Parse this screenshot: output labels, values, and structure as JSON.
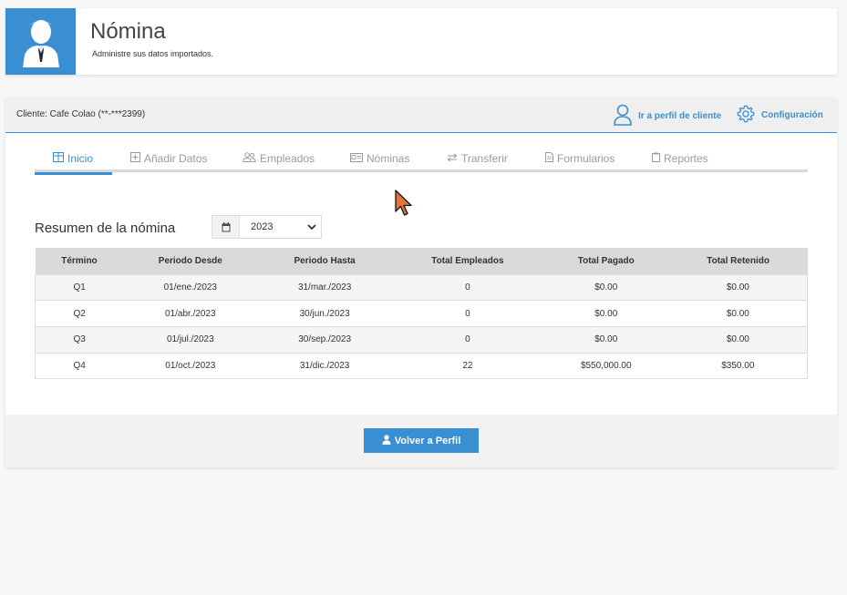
{
  "header": {
    "title": "Nómina",
    "subtitle": "Administre sus datos importados."
  },
  "client_bar": {
    "client_label": "Cliente: Cafe Colao (**-***2399)",
    "profile_link": "Ir a perfil de cliente",
    "settings_link": "Configuración"
  },
  "tabs": [
    {
      "label": "Inicio",
      "icon": "table-icon",
      "active": true
    },
    {
      "label": "Añadir Datos",
      "icon": "plus-square-icon",
      "active": false
    },
    {
      "label": "Empleados",
      "icon": "users-icon",
      "active": false
    },
    {
      "label": "Nóminas",
      "icon": "id-card-icon",
      "active": false
    },
    {
      "label": "Transferir",
      "icon": "transfer-icon",
      "active": false
    },
    {
      "label": "Formularios",
      "icon": "document-icon",
      "active": false
    },
    {
      "label": "Reportes",
      "icon": "clipboard-icon",
      "active": false
    }
  ],
  "summary": {
    "title": "Resumen de la nómina",
    "year": "2023",
    "columns": [
      "Término",
      "Periodo Desde",
      "Periodo Hasta",
      "Total Empleados",
      "Total Pagado",
      "Total Retenido"
    ],
    "rows": [
      [
        "Q1",
        "01/ene./2023",
        "31/mar./2023",
        "0",
        "$0.00",
        "$0.00"
      ],
      [
        "Q2",
        "01/abr./2023",
        "30/jun./2023",
        "0",
        "$0.00",
        "$0.00"
      ],
      [
        "Q3",
        "01/jul./2023",
        "30/sep./2023",
        "0",
        "$0.00",
        "$0.00"
      ],
      [
        "Q4",
        "01/oct./2023",
        "31/dic./2023",
        "22",
        "$550,000.00",
        "$350.00"
      ]
    ]
  },
  "footer": {
    "back_button": "Volver a Perfil"
  },
  "colors": {
    "accent": "#3a8fd3",
    "cursor": "#e8743b"
  }
}
